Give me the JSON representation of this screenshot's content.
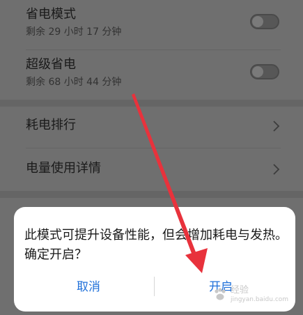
{
  "settings": {
    "power_saving": {
      "title": "省电模式",
      "remaining": "剩余 29 小时 17 分钟",
      "enabled": false
    },
    "ultra_power_saving": {
      "title": "超级省电",
      "remaining": "剩余 68 小时 44 分钟",
      "enabled": false
    },
    "power_ranking": {
      "title": "耗电排行"
    },
    "power_usage_details": {
      "title": "电量使用详情"
    }
  },
  "dialog": {
    "message": "此模式可提升设备性能，但会增加耗电与发热。确定开启？",
    "cancel_label": "取消",
    "confirm_label": "开启"
  },
  "watermark": {
    "text": "经验",
    "sub": "jingyan.baidu.com"
  },
  "colors": {
    "accent": "#1e6fd9",
    "annotation_arrow": "#e8323c"
  }
}
